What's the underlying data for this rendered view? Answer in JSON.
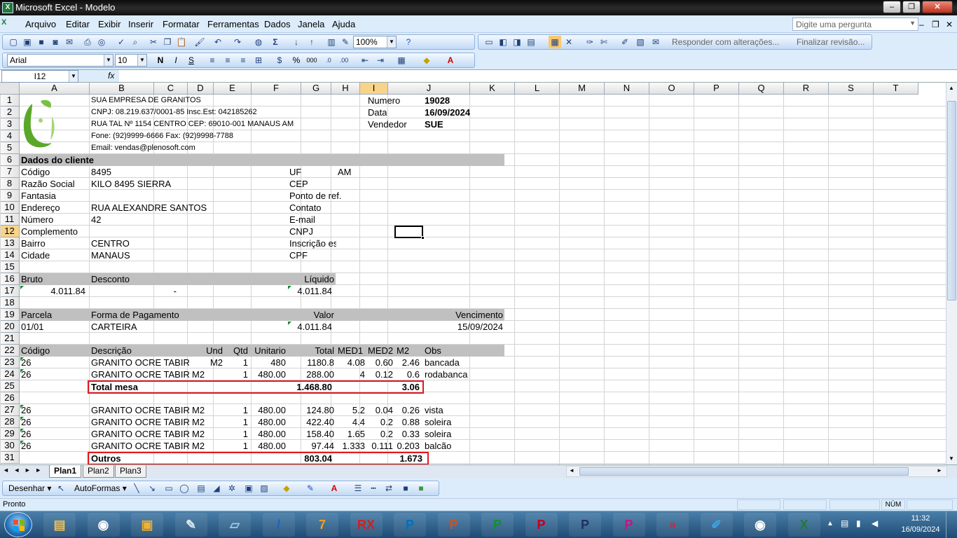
{
  "window": {
    "title": "Microsoft Excel - Modelo",
    "minimize": "–",
    "restore": "❐",
    "close": "✕"
  },
  "menu": {
    "items": [
      "Arquivo",
      "Editar",
      "Exibir",
      "Inserir",
      "Formatar",
      "Ferramentas",
      "Dados",
      "Janela",
      "Ajuda"
    ],
    "help_placeholder": "Digite uma pergunta",
    "doc_min": "–",
    "doc_restore": "❐",
    "doc_close": "✕"
  },
  "toolbar": {
    "zoom": "100%",
    "review_reply": "Responder com alterações...",
    "review_finish": "Finalizar revisão...",
    "font": "Arial",
    "font_size": "10",
    "bold": "N",
    "italic": "I",
    "underline": "S",
    "percent": "%",
    "thousands": "000",
    "sum": "Σ",
    "doc_icon": "X"
  },
  "formula": {
    "name_box": "I12",
    "fx": "fx",
    "value": ""
  },
  "columns": [
    "A",
    "B",
    "C",
    "D",
    "E",
    "F",
    "G",
    "H",
    "I",
    "J",
    "K",
    "L",
    "M",
    "N",
    "O",
    "P",
    "Q",
    "R",
    "S",
    "T"
  ],
  "selected_cell": "I12",
  "rows": [
    "1",
    "2",
    "3",
    "4",
    "5",
    "6",
    "7",
    "8",
    "9",
    "10",
    "11",
    "12",
    "13",
    "14",
    "15",
    "16",
    "17",
    "18",
    "19",
    "20",
    "21",
    "22",
    "23",
    "24",
    "25",
    "26",
    "27",
    "28",
    "29",
    "30",
    "31"
  ],
  "company": {
    "name": "SUA EMPRESA DE GRANITOS",
    "cnpj": "CNPJ: 08.219.637/0001-85 Insc.Est: 042185262",
    "address": "RUA TAL Nº 1154 CENTRO CEP: 69010-001 MANAUS AM",
    "phone": "Fone: (92)9999-6666 Fax: (92)9998-7788",
    "email": "Email: vendas@plenosoft.com"
  },
  "order": {
    "numero_label": "Numero",
    "numero": "19028",
    "data_label": "Data",
    "data": "16/09/2024",
    "vendedor_label": "Vendedor",
    "vendedor": "SUE"
  },
  "client": {
    "header": "Dados do cliente",
    "codigo_label": "Código",
    "codigo": "8495",
    "razao_label": "Razão Social",
    "razao": "KILO 8495 SIERRA",
    "fantasia_label": "Fantasia",
    "endereco_label": "Endereço",
    "endereco": "RUA ALEXANDRE SANTOS",
    "numero_label": "Número",
    "numero": "42",
    "complemento_label": "Complemento",
    "bairro_label": "Bairro",
    "bairro": "CENTRO",
    "cidade_label": "Cidade",
    "cidade": "MANAUS",
    "uf_label": "UF",
    "uf": "AM",
    "cep_label": "CEP",
    "ponto_label": "Ponto de ref.",
    "contato_label": "Contato",
    "email_label": "E-mail",
    "cnpj_label": "CNPJ",
    "inscricao_label": "Inscrição es",
    "cpf_label": "CPF"
  },
  "totals": {
    "bruto_label": "Bruto",
    "desconto_label": "Desconto",
    "liquido_label": "Líquido",
    "bruto": "4.011.84",
    "desconto": "-",
    "liquido": "4.011.84"
  },
  "payment": {
    "parcela_label": "Parcela",
    "forma_label": "Forma de Pagamento",
    "valor_label": "Valor",
    "vencimento_label": "Vencimento",
    "parcela": "01/01",
    "forma": "CARTEIRA",
    "valor": "4.011.84",
    "vencimento": "15/09/2024"
  },
  "items": {
    "headers": {
      "codigo": "Código",
      "descricao": "Descrição",
      "und": "Und",
      "qtd": "Qtd",
      "unitario": "Unitario",
      "total": "Total",
      "med1": "MED1",
      "med2": "MED2",
      "m2": "M2",
      "obs": "Obs"
    },
    "mesa": [
      {
        "codigo": "26",
        "descricao": "GRANITO OCRE TABIRA",
        "und": "M2",
        "qtd": "1",
        "unitario": "480",
        "total": "1180.8",
        "med1": "4.08",
        "med2": "0.60",
        "m2": "2.46",
        "obs": "bancada"
      },
      {
        "codigo": "26",
        "descricao": "GRANITO OCRE TABIRA",
        "und": "M2",
        "qtd": "1",
        "unitario": "480.00",
        "total": "288.00",
        "med1": "4",
        "med2": "0.12",
        "m2": "0.6",
        "obs": "rodabanca"
      }
    ],
    "mesa_total": {
      "label": "Total mesa",
      "total": "1.468.80",
      "m2": "3.06"
    },
    "outros": [
      {
        "codigo": "26",
        "descricao": "GRANITO OCRE TABIRA",
        "und": "M2",
        "qtd": "1",
        "unitario": "480.00",
        "total": "124.80",
        "med1": "5.2",
        "med2": "0.04",
        "m2": "0.26",
        "obs": "vista"
      },
      {
        "codigo": "26",
        "descricao": "GRANITO OCRE TABIRA",
        "und": "M2",
        "qtd": "1",
        "unitario": "480.00",
        "total": "422.40",
        "med1": "4.4",
        "med2": "0.2",
        "m2": "0.88",
        "obs": "soleira"
      },
      {
        "codigo": "26",
        "descricao": "GRANITO OCRE TABIRA",
        "und": "M2",
        "qtd": "1",
        "unitario": "480.00",
        "total": "158.40",
        "med1": "1.65",
        "med2": "0.2",
        "m2": "0.33",
        "obs": "soleira"
      },
      {
        "codigo": "26",
        "descricao": "GRANITO OCRE TABIRA",
        "und": "M2",
        "qtd": "1",
        "unitario": "480.00",
        "total": "97.44",
        "med1": "1.333",
        "med2": "0.111",
        "m2": "0.203",
        "obs": "balcão"
      }
    ],
    "outros_total": {
      "label": "Outros",
      "total": "803.04",
      "m2": "1.673"
    }
  },
  "sheets": {
    "tabs": [
      "Plan1",
      "Plan2",
      "Plan3"
    ],
    "active": "Plan1",
    "nav": "◄ ◄ ► ►"
  },
  "drawing": {
    "desenhar": "Desenhar",
    "autoformas": "AutoFormas"
  },
  "status": {
    "left": "Pronto",
    "num": "NÚM"
  },
  "taskbar": {
    "apps": [
      "explorer-icon",
      "chrome-icon",
      "paint-icon",
      "paintbrush-icon",
      "notes-icon",
      "app-slash-icon",
      "app-7-icon",
      "rx-icon",
      "app-p-icon",
      "app-p-icon",
      "app-p-icon",
      "app-p-icon",
      "app-p-icon",
      "app-p-icon",
      "app-arrow-icon",
      "app-brush-icon",
      "chrome-icon",
      "excel-icon"
    ],
    "time": "11:32",
    "date": "16/09/2024"
  },
  "colors": {
    "title": "#1a1a1a",
    "menu": "#dcecfb",
    "band": "#c0c0c0",
    "red_box": "#e0191e",
    "selected_header": "#f8d38a"
  }
}
